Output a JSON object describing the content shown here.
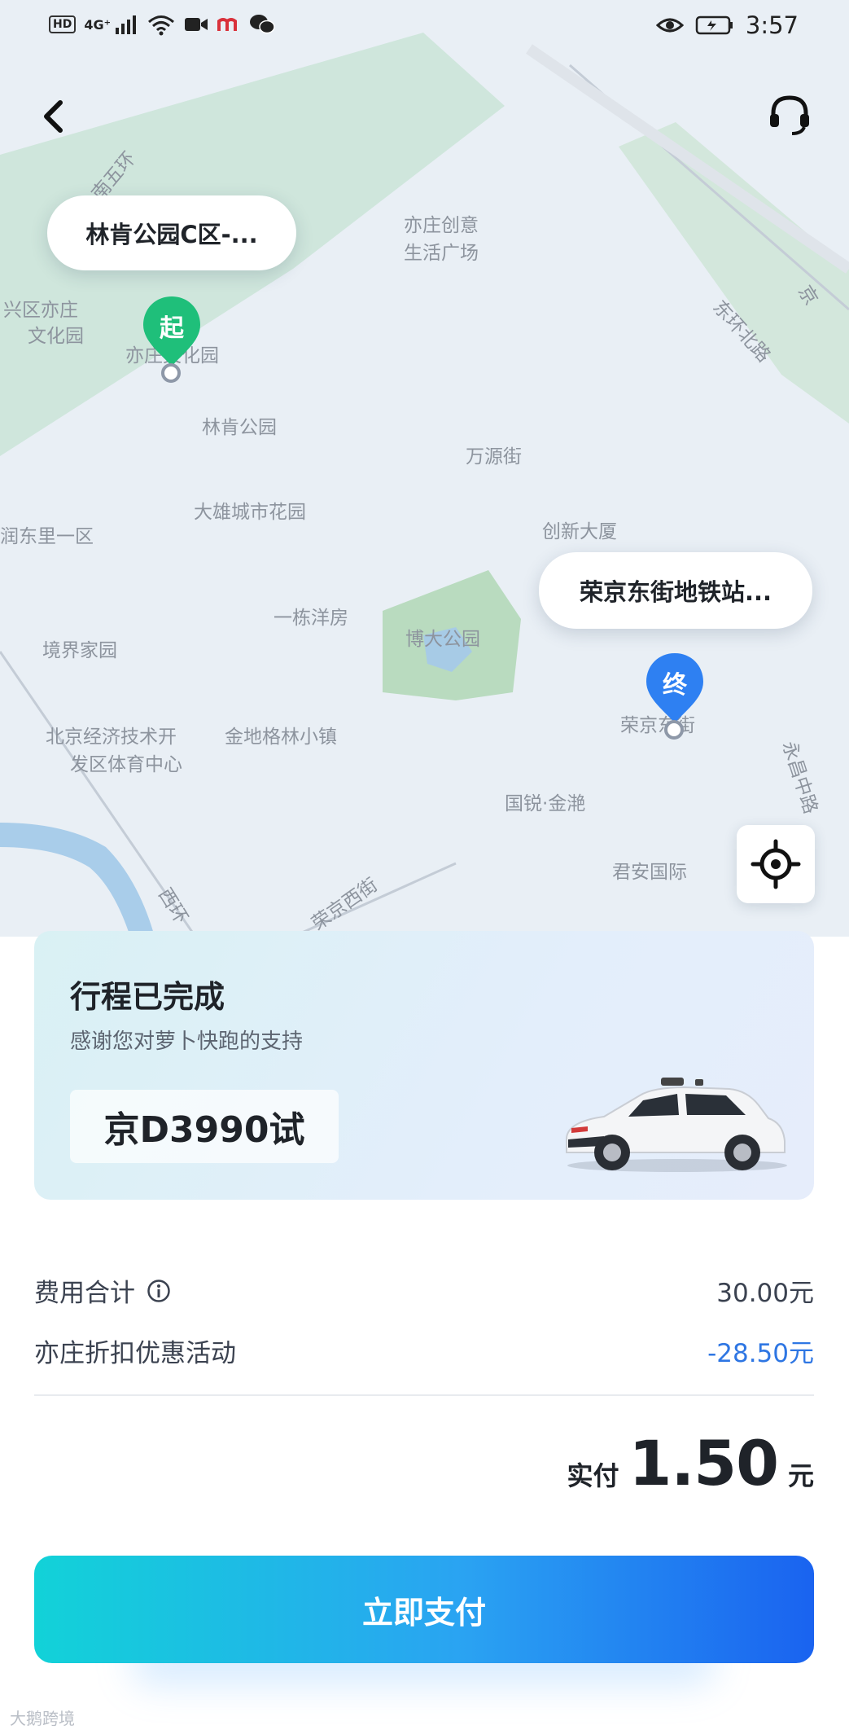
{
  "status_bar": {
    "left_chips": [
      "HD",
      "4G⁺"
    ],
    "time": "3:57"
  },
  "map": {
    "labels": [
      "南五环",
      "亦庄创意",
      "生活广场",
      "兴区亦庄",
      "文化园",
      "亦庄文化园",
      "林肯公园",
      "万源街",
      "大雄城市花园",
      "创新大厦",
      "润东里一区",
      "一栋洋房",
      "博大公园",
      "境界家园",
      "北京经济技术开",
      "发区体育中心",
      "金地格林小镇",
      "荣京东街",
      "国锐·金滟",
      "君安国际",
      "荣京西街",
      "东环北路",
      "永昌中路",
      "西环",
      "京"
    ],
    "start_marker": {
      "label": "起",
      "bubble": "林肯公园C区-..."
    },
    "end_marker": {
      "label": "终",
      "bubble": "荣京东街地铁站..."
    }
  },
  "trip": {
    "title": "行程已完成",
    "subtitle": "感谢您对萝卜快跑的支持",
    "plate": "京D3990试"
  },
  "fare": {
    "total_label": "费用合计",
    "total_value": "30.00元",
    "discount_label": "亦庄折扣优惠活动",
    "discount_value": "-28.50元",
    "paid_label": "实付",
    "paid_value": "1.50",
    "paid_unit": "元"
  },
  "actions": {
    "pay_label": "立即支付"
  },
  "watermark": "大鹅跨境",
  "colors": {
    "accent_green": "#1fbf7a",
    "accent_blue": "#2e80f2",
    "discount_blue": "#2e76e3",
    "pay_gradient_start": "#12d2d8",
    "pay_gradient_end": "#1a63f0"
  },
  "icons": [
    "back-arrow-icon",
    "headset-icon",
    "locate-icon",
    "info-icon",
    "car-image",
    "eye-icon",
    "battery-icon"
  ]
}
